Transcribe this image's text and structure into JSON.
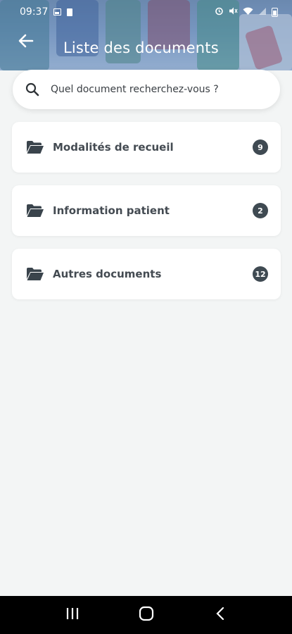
{
  "status_bar": {
    "time": "09:37",
    "icons": [
      "image-notification-icon",
      "document-notification-icon",
      "alarm-icon",
      "mute-icon",
      "wifi-icon",
      "signal-icon",
      "battery-icon"
    ]
  },
  "header": {
    "title": "Liste des documents",
    "back_icon": "arrow-left-icon"
  },
  "search": {
    "placeholder": "Quel document recherchez-vous ?",
    "value": ""
  },
  "categories": [
    {
      "label": "Modalités de recueil",
      "count": "9",
      "icon": "folder-open-icon"
    },
    {
      "label": "Information patient",
      "count": "2",
      "icon": "folder-open-icon"
    },
    {
      "label": "Autres documents",
      "count": "12",
      "icon": "folder-open-icon"
    }
  ],
  "nav_bar": {
    "buttons": [
      "recent-apps-icon",
      "home-icon",
      "back-icon"
    ]
  },
  "colors": {
    "background": "#f3f5f5",
    "badge": "#3f4a52",
    "text": "#444b52",
    "header_tint": "#7d9cc2"
  }
}
